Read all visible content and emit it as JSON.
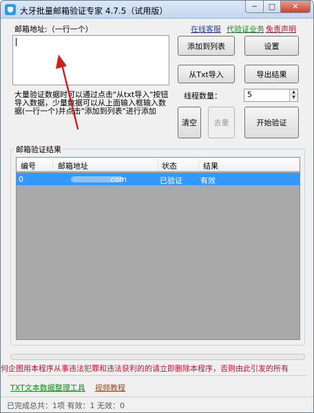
{
  "window": {
    "title": "大牙批量邮箱验证专家 4.7.5（试用版）",
    "controls": {
      "minimize": "─",
      "maximize": "□",
      "close": "✕"
    }
  },
  "links": {
    "online_support": "在线客服",
    "proxy_verify": "代验证业务",
    "disclaimer": "免责声明"
  },
  "input": {
    "label": "邮箱地址:（一行一个）",
    "value": ""
  },
  "buttons": {
    "add_to_list": "添加到列表",
    "settings": "设置",
    "import_txt": "从Txt导入",
    "export_results": "导出结果",
    "clear": "清空",
    "dedupe": "去重",
    "start_verify": "开始验证"
  },
  "hint_text": "大量验证数据时可以通过点击\"从txt导入\"按钮导入数据，少量数据可以从上面输入框输入数据(一行一个)并点击\"添加到列表\"进行添加",
  "threads": {
    "label": "线程数量：",
    "value": "5"
  },
  "results": {
    "label": "邮箱验证结果",
    "columns": [
      "编号",
      "邮箱地址",
      "状态",
      "结果"
    ],
    "rows": [
      {
        "id": "0",
        "email_suffix": ".com",
        "status": "已验证",
        "result": "有效"
      }
    ]
  },
  "warning_marquee": "何企图用本程序从事违法犯罪和违法获利的的请立即删除本程序，否则由此引发的所有",
  "footer_links": {
    "txt_tool": "TXT文本数据整理工具",
    "video_tutorial": "视频教程"
  },
  "status": "已完成总共：1项 有效：1  无效：0",
  "colors": {
    "selection": "#3399ff",
    "link_blue": "#1a3fb8",
    "link_green": "#138a1c",
    "link_red": "#c8102e",
    "arrow_red": "#d01f1f"
  }
}
